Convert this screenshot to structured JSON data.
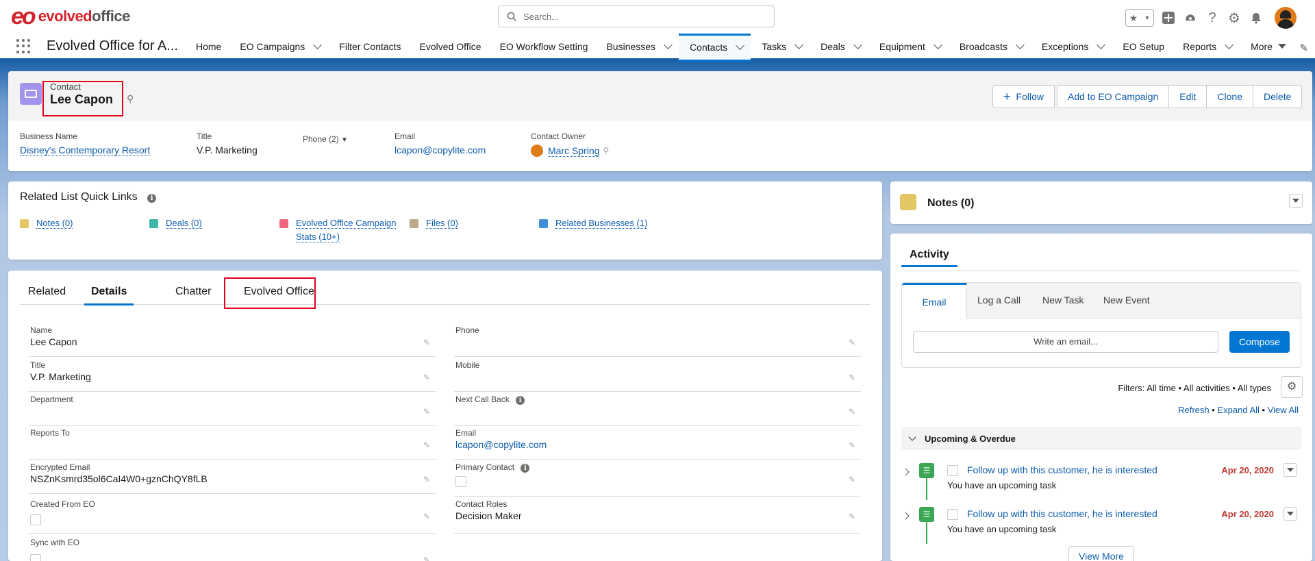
{
  "header": {
    "logo_mark": "eo",
    "logo_text_a": "evolved",
    "logo_text_b": "office",
    "search_placeholder": "Search..."
  },
  "nav": {
    "app_name": "Evolved Office for A...",
    "items": [
      {
        "label": "Home",
        "dropdown": false
      },
      {
        "label": "EO Campaigns",
        "dropdown": true
      },
      {
        "label": "Filter Contacts",
        "dropdown": false
      },
      {
        "label": "Evolved Office",
        "dropdown": false
      },
      {
        "label": "EO Workflow Setting",
        "dropdown": false
      },
      {
        "label": "Businesses",
        "dropdown": true
      },
      {
        "label": "Contacts",
        "dropdown": true,
        "active": true
      },
      {
        "label": "Tasks",
        "dropdown": true
      },
      {
        "label": "Deals",
        "dropdown": true
      },
      {
        "label": "Equipment",
        "dropdown": true
      },
      {
        "label": "Broadcasts",
        "dropdown": true
      },
      {
        "label": "Exceptions",
        "dropdown": true
      },
      {
        "label": "EO Setup",
        "dropdown": false
      },
      {
        "label": "Reports",
        "dropdown": true
      },
      {
        "label": "More",
        "dropdown": true
      }
    ]
  },
  "record": {
    "object_label": "Contact",
    "name": "Lee Capon",
    "buttons": {
      "follow": "Follow",
      "add_campaign": "Add to EO Campaign",
      "edit": "Edit",
      "clone": "Clone",
      "delete": "Delete"
    },
    "highlights": {
      "business_label": "Business Name",
      "business_value": "Disney's Contemporary Resort",
      "title_label": "Title",
      "title_value": "V.P. Marketing",
      "phone_label": "Phone (2)",
      "email_label": "Email",
      "email_value": "lcapon@copylite.com",
      "owner_label": "Contact Owner",
      "owner_value": "Marc Spring"
    }
  },
  "quick_links": {
    "title": "Related List Quick Links",
    "items": [
      {
        "label": "Notes (0)",
        "color": "#e3c764"
      },
      {
        "label": "Deals (0)",
        "color": "#3bb8a6"
      },
      {
        "label": "Evolved Office Campaign",
        "label2": "Stats (10+)",
        "color": "#f0657e"
      },
      {
        "label": "Files (0)",
        "color": "#bba98a"
      },
      {
        "label": "Related Businesses (1)",
        "color": "#3e8fd8"
      }
    ]
  },
  "notes": {
    "title": "Notes (0)"
  },
  "tabs": {
    "related": "Related",
    "details": "Details",
    "chatter": "Chatter",
    "evolved_office": "Evolved Office"
  },
  "details": {
    "left": [
      {
        "label": "Name",
        "value": "Lee Capon"
      },
      {
        "label": "Title",
        "value": "V.P. Marketing"
      },
      {
        "label": "Department",
        "value": ""
      },
      {
        "label": "Reports To",
        "value": ""
      },
      {
        "label": "Encrypted Email",
        "value": "NSZnKsmrd35ol6CaI4W0+gznChQY8fLB"
      },
      {
        "label": "Created From EO",
        "value": ""
      },
      {
        "label": "Sync with EO",
        "value": ""
      }
    ],
    "right": [
      {
        "label": "Phone",
        "value": ""
      },
      {
        "label": "Mobile",
        "value": ""
      },
      {
        "label": "Next Call Back",
        "value": ""
      },
      {
        "label": "Email",
        "value": "lcapon@copylite.com"
      },
      {
        "label": "Primary Contact",
        "value": ""
      },
      {
        "label": "Contact Roles",
        "value": "Decision Maker"
      }
    ]
  },
  "activity": {
    "title": "Activity",
    "tabs": {
      "email": "Email",
      "log_call": "Log a Call",
      "new_task": "New Task",
      "new_event": "New Event"
    },
    "email_placeholder": "Write an email...",
    "compose": "Compose",
    "filters": "Filters: All time • All activities • All types",
    "refresh": "Refresh",
    "expand_all": "Expand All",
    "view_all": "View All",
    "section": "Upcoming & Overdue",
    "tasks": [
      {
        "title": "Follow up with this customer, he is interested",
        "sub": "You have an upcoming task",
        "date": "Apr 20, 2020"
      },
      {
        "title": "Follow up with this customer, he is interested",
        "sub": "You have an upcoming task",
        "date": "Apr 20, 2020"
      }
    ],
    "view_more": "View More"
  }
}
